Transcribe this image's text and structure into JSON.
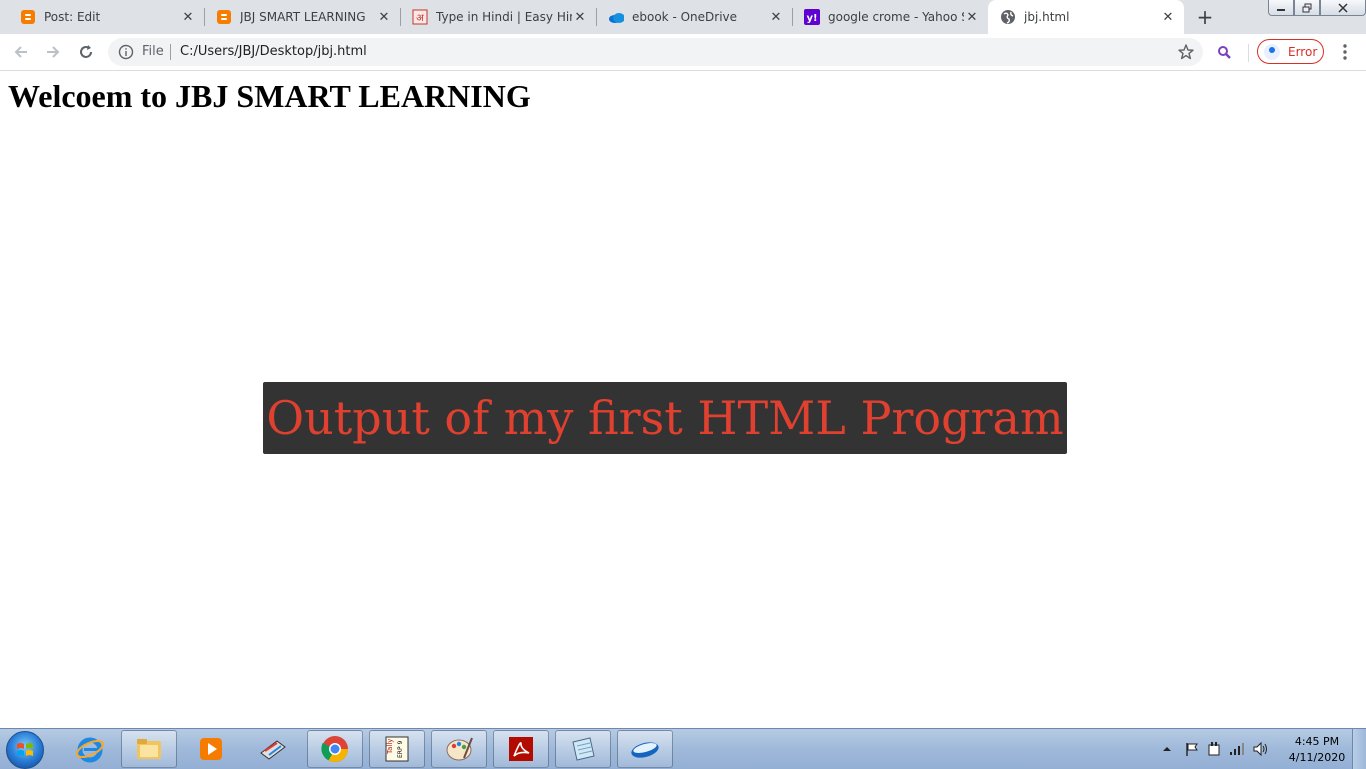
{
  "browser": {
    "tabs": [
      {
        "title": "Post: Edit",
        "icon": "blogger-icon"
      },
      {
        "title": "JBJ SMART LEARNING",
        "icon": "blogger-icon"
      },
      {
        "title": "Type in Hindi | Easy Hindi",
        "icon": "hindi-letter-icon"
      },
      {
        "title": "ebook - OneDrive",
        "icon": "onedrive-icon"
      },
      {
        "title": "google crome - Yahoo Sea",
        "icon": "yahoo-icon"
      },
      {
        "title": "jbj.html",
        "icon": "globe-icon",
        "active": true
      }
    ],
    "address": {
      "scheme_label": "File",
      "url": "C:/Users/JBJ/Desktop/jbj.html"
    },
    "profile_status": "Error"
  },
  "page": {
    "heading": "Welcoem to JBJ SMART LEARNING",
    "output_text": "Output of my first HTML Program"
  },
  "taskbar": {
    "pinned": [
      "internet-explorer",
      "windows-explorer",
      "media-player",
      "scanner",
      "chrome",
      "tally-erp9",
      "paint",
      "acrobat-reader",
      "notepad-like",
      "app-swoosh"
    ],
    "clock_time": "4:45 PM",
    "clock_date": "4/11/2020"
  },
  "colors": {
    "tab_strip": "#dee1e6",
    "output_bg": "#333333",
    "output_text": "#e0402f",
    "error_red": "#d93025"
  }
}
